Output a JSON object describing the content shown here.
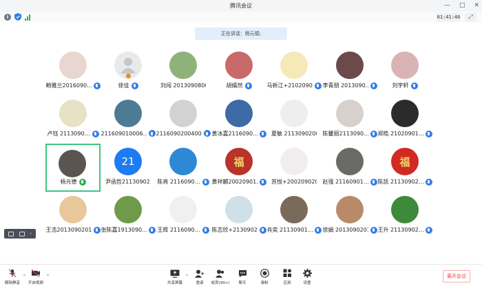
{
  "window": {
    "title": "腾讯会议",
    "controls": [
      "—",
      "□",
      "✕"
    ]
  },
  "topbar": {
    "timer": "01:41:46"
  },
  "speaking": {
    "text": "正在讲话：杨元德;"
  },
  "participants": [
    {
      "name": "鲍雅兰2016090…",
      "avatar_bg": "#e8d7d0",
      "avatar_fg": "",
      "mic": "blue"
    },
    {
      "name": "徐佳",
      "avatar_bg": "#e9eaec",
      "avatar_fg": "",
      "mic": "blue",
      "default_avatar": true
    },
    {
      "name": "刘闯 201309080017",
      "avatar_bg": "#8fb27a",
      "avatar_fg": "",
      "mic": "none"
    },
    {
      "name": "胡婿然",
      "avatar_bg": "#c96a6a",
      "avatar_fg": "",
      "mic": "blue"
    },
    {
      "name": "马新江+2102090…",
      "avatar_bg": "#f5e9b8",
      "avatar_fg": "",
      "mic": "blue"
    },
    {
      "name": "李青朋 2013090…",
      "avatar_bg": "#6a4a4a",
      "avatar_fg": "",
      "mic": "blue"
    },
    {
      "name": "刘宇轩",
      "avatar_bg": "#d9b4b4",
      "avatar_fg": "",
      "mic": "blue"
    },
    {
      "name": "卢钰 2113090…",
      "avatar_bg": "#e7e1c6",
      "avatar_fg": "",
      "mic": "blue"
    },
    {
      "name": "211609010006…",
      "avatar_bg": "#4d7b93",
      "avatar_fg": "",
      "mic": "blue"
    },
    {
      "name": "2116090200400…",
      "avatar_bg": "#d2d2d2",
      "avatar_fg": "",
      "mic": "blue"
    },
    {
      "name": "黄冰嘉2116090…",
      "avatar_bg": "#3e6aa5",
      "avatar_fg": "",
      "mic": "blue"
    },
    {
      "name": "夏敏 211309020034",
      "avatar_bg": "#eeeeee",
      "avatar_fg": "",
      "mic": "none"
    },
    {
      "name": "陈馨丽2113090…",
      "avatar_bg": "#d8d0cc",
      "avatar_fg": "",
      "mic": "blue"
    },
    {
      "name": "郑皓 21020901…",
      "avatar_bg": "#2b2b2b",
      "avatar_fg": "",
      "mic": "blue"
    },
    {
      "name": "杨元德",
      "avatar_bg": "#5a5550",
      "avatar_fg": "",
      "mic": "green",
      "active": true
    },
    {
      "name": "尹函哲21130902…",
      "avatar_bg": "#1d7cf2",
      "avatar_fg": "21",
      "mic": "none"
    },
    {
      "name": "陈亮 2116090…",
      "avatar_bg": "#2f88d6",
      "avatar_fg": "",
      "mic": "blue"
    },
    {
      "name": "黄祥麟20020901…",
      "avatar_bg": "#b8332a",
      "avatar_fg": "福",
      "mic": "blue"
    },
    {
      "name": "苏悦+200209020008",
      "avatar_bg": "#f2eef0",
      "avatar_fg": "",
      "mic": "none"
    },
    {
      "name": "赵强 21160901…",
      "avatar_bg": "#6b6a66",
      "avatar_fg": "",
      "mic": "blue"
    },
    {
      "name": "陈凯 21130902…",
      "avatar_bg": "#d12a22",
      "avatar_fg": "福",
      "mic": "blue"
    },
    {
      "name": "王浩2013090201…",
      "avatar_bg": "#e8c79a",
      "avatar_fg": "",
      "mic": "blue"
    },
    {
      "name": "张陈嘉1913090…",
      "avatar_bg": "#6e9a4a",
      "avatar_fg": "",
      "mic": "blue"
    },
    {
      "name": "王辉 2116090…",
      "avatar_bg": "#f0f0f0",
      "avatar_fg": "",
      "mic": "blue"
    },
    {
      "name": "陈志欣+2130902…",
      "avatar_bg": "#cfe0e8",
      "avatar_fg": "",
      "mic": "blue"
    },
    {
      "name": "肖奕 21130901…",
      "avatar_bg": "#7a6a5a",
      "avatar_fg": "",
      "mic": "blue"
    },
    {
      "name": "徐娟 2013090201…",
      "avatar_bg": "#b88a6a",
      "avatar_fg": "",
      "mic": "blue"
    },
    {
      "name": "王升 21130902…",
      "avatar_bg": "#3c8a3a",
      "avatar_fg": "",
      "mic": "blue"
    }
  ],
  "toolbar": {
    "mute": "解除静音",
    "video": "开启视频",
    "share": "共享屏幕",
    "invite": "邀请",
    "members": "成员(99+)",
    "chat": "聊天",
    "record": "录制",
    "apps": "应用",
    "settings": "设置",
    "leave": "离开会议"
  }
}
